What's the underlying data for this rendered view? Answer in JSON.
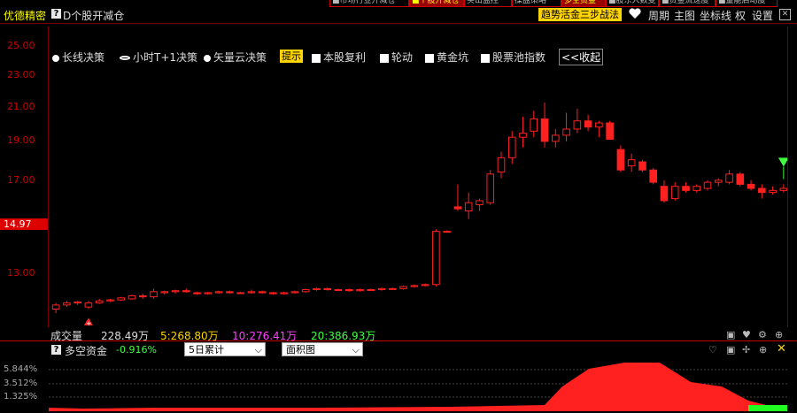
{
  "tabs": [
    {
      "label": "■市场行业开减仓",
      "active": false
    },
    {
      "label": "■个股开减仓",
      "active": true
    },
    {
      "label": "买出监控",
      "active": false
    },
    {
      "label": "操盘策略",
      "active": false
    },
    {
      "label": "多空资金",
      "active": true
    },
    {
      "label": "■股东人数变",
      "active": false
    },
    {
      "label": "■资金流速度",
      "active": false
    },
    {
      "label": "■量能启动度",
      "active": false
    }
  ],
  "header": {
    "brand": "优德精密",
    "title": "D个股开减仓",
    "trend_button": "趋势活金三步战法",
    "menu": [
      "周期",
      "主图",
      "坐标线",
      "权",
      "设置"
    ]
  },
  "y_axis": {
    "labels": [
      "25.00",
      "23.00",
      "21.00",
      "19.00",
      "17.00",
      "13.00"
    ],
    "current": "14.97"
  },
  "controls": {
    "radios": [
      "长线决策",
      "小时T+1决策",
      "矢量云决策"
    ],
    "selected_radio": 1,
    "tip": "提示",
    "checks": [
      "本股复利",
      "轮动",
      "黄金坑",
      "股票池指数"
    ],
    "collapse": "<<收起"
  },
  "volume": {
    "label": "成交量",
    "value": "228.49万",
    "ma5": "5:268.80万",
    "ma10": "10:276.41万",
    "ma20": "20:386.93万"
  },
  "dkzj": {
    "label": "多空资金",
    "value": "-0.916%",
    "period": "5日累计",
    "chart_type": "面积图",
    "levels": [
      "5.844%",
      "3.512%",
      "1.325%"
    ]
  },
  "chart_data": {
    "type": "candlestick",
    "ohlc": [
      [
        12.1,
        12.4,
        11.9,
        12.3
      ],
      [
        12.3,
        12.5,
        12.2,
        12.4
      ],
      [
        12.4,
        12.5,
        12.3,
        12.45
      ],
      [
        12.2,
        12.5,
        12.1,
        12.4
      ],
      [
        12.4,
        12.6,
        12.35,
        12.5
      ],
      [
        12.5,
        12.6,
        12.45,
        12.55
      ],
      [
        12.55,
        12.7,
        12.5,
        12.65
      ],
      [
        12.6,
        12.8,
        12.55,
        12.75
      ],
      [
        12.75,
        12.85,
        12.6,
        12.7
      ],
      [
        12.7,
        13.1,
        12.6,
        12.95
      ],
      [
        12.9,
        13.0,
        12.8,
        12.95
      ],
      [
        12.95,
        13.05,
        12.85,
        13.0
      ],
      [
        13.0,
        13.1,
        12.9,
        12.95
      ],
      [
        12.9,
        12.95,
        12.8,
        12.85
      ],
      [
        12.85,
        12.95,
        12.8,
        12.9
      ],
      [
        12.9,
        13.0,
        12.85,
        12.95
      ],
      [
        12.95,
        13.0,
        12.85,
        12.9
      ],
      [
        12.9,
        12.95,
        12.85,
        12.9
      ],
      [
        12.9,
        13.05,
        12.85,
        12.95
      ],
      [
        12.95,
        13.0,
        12.85,
        12.9
      ],
      [
        12.9,
        12.95,
        12.8,
        12.85
      ],
      [
        12.85,
        12.95,
        12.8,
        12.9
      ],
      [
        12.9,
        13.0,
        12.85,
        12.95
      ],
      [
        12.95,
        13.1,
        12.9,
        13.05
      ],
      [
        13.05,
        13.15,
        13.0,
        13.1
      ],
      [
        13.1,
        13.15,
        13.0,
        13.05
      ],
      [
        13.05,
        13.1,
        13.0,
        13.05
      ],
      [
        13.05,
        13.1,
        12.95,
        13.0
      ],
      [
        13.0,
        13.1,
        12.95,
        13.05
      ],
      [
        13.05,
        13.1,
        13.0,
        13.05
      ],
      [
        13.05,
        13.15,
        13.0,
        13.1
      ],
      [
        13.1,
        13.15,
        13.05,
        13.1
      ],
      [
        13.1,
        13.25,
        13.05,
        13.2
      ],
      [
        13.2,
        13.3,
        13.15,
        13.25
      ],
      [
        13.25,
        13.35,
        13.2,
        13.3
      ],
      [
        13.3,
        16.0,
        13.2,
        15.9
      ],
      [
        15.9,
        15.95,
        15.85,
        15.9
      ],
      [
        17.1,
        18.2,
        16.9,
        17.0
      ],
      [
        16.9,
        17.8,
        16.5,
        17.3
      ],
      [
        17.2,
        17.5,
        16.9,
        17.4
      ],
      [
        17.3,
        18.9,
        17.2,
        18.7
      ],
      [
        18.8,
        19.8,
        18.5,
        19.5
      ],
      [
        19.5,
        20.8,
        19.2,
        20.5
      ],
      [
        20.5,
        21.5,
        20.0,
        20.7
      ],
      [
        20.8,
        21.8,
        20.5,
        21.4
      ],
      [
        21.4,
        22.2,
        20.0,
        20.3
      ],
      [
        20.3,
        20.9,
        20.0,
        20.6
      ],
      [
        20.6,
        21.7,
        20.3,
        20.9
      ],
      [
        20.9,
        21.9,
        20.7,
        21.3
      ],
      [
        21.3,
        21.6,
        20.8,
        21.0
      ],
      [
        21.0,
        21.3,
        20.5,
        21.2
      ],
      [
        21.2,
        21.3,
        20.4,
        20.4
      ],
      [
        19.9,
        20.1,
        18.8,
        18.9
      ],
      [
        19.1,
        19.7,
        18.8,
        19.4
      ],
      [
        19.3,
        19.4,
        18.8,
        18.9
      ],
      [
        18.9,
        19.0,
        18.2,
        18.3
      ],
      [
        18.1,
        18.4,
        17.3,
        17.4
      ],
      [
        17.5,
        18.3,
        17.4,
        18.1
      ],
      [
        18.1,
        18.3,
        17.8,
        17.9
      ],
      [
        17.9,
        18.2,
        17.8,
        18.1
      ],
      [
        18.0,
        18.4,
        17.9,
        18.3
      ],
      [
        18.3,
        18.5,
        18.1,
        18.4
      ],
      [
        18.3,
        18.9,
        18.2,
        18.7
      ],
      [
        18.7,
        18.8,
        18.1,
        18.2
      ],
      [
        18.2,
        18.4,
        17.9,
        18.0
      ],
      [
        18.0,
        18.2,
        17.5,
        17.8
      ],
      [
        17.8,
        18.1,
        17.7,
        17.9
      ],
      [
        17.9,
        18.2,
        17.8,
        18.0
      ]
    ],
    "ylim": [
      11.3,
      26.0
    ],
    "up_color": "#ff2020",
    "down_color": "#ff2020"
  }
}
